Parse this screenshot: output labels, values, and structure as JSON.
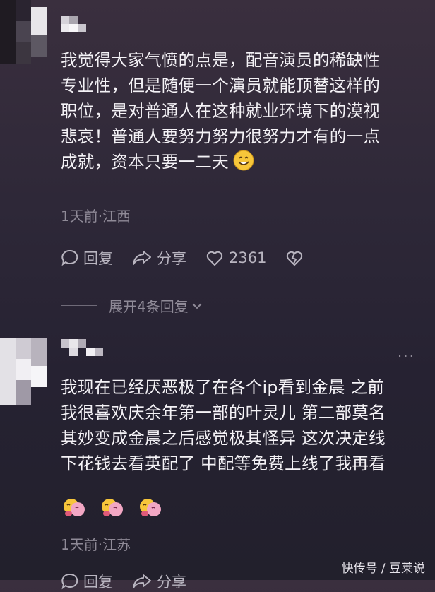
{
  "comments": [
    {
      "text_lines": [
        "我觉得大家气愤的点是，配音演员的稀缺性",
        "专业性，但是随便一个演员就能顶替这样的",
        "职位，是对普通人在这种就业环境下的漠视",
        "悲哀！普通人要努力努力很努力才有的一点",
        "成就，资本只要一二天"
      ],
      "trailing_emoji": "smile-emoji",
      "meta": "1天前·江西",
      "reply_label": "回复",
      "share_label": "分享",
      "like_count": "2361",
      "expand_label": "展开4条回复"
    },
    {
      "text_lines": [
        "我现在已经厌恶极了在各个ip看到金晨 之前",
        "我很喜欢庆余年第一部的叶灵儿 第二部莫名",
        "其妙变成金晨之后感觉极其怪异 这次决定线",
        "下花钱去看英配了 中配等免费上线了我再看"
      ],
      "emoji_row": [
        "hug-emoji",
        "hug-emoji",
        "hug-emoji"
      ],
      "meta": "1天前·江苏",
      "reply_label": "回复",
      "share_label": "分享",
      "more_label": "···"
    }
  ],
  "watermark": "快传号 / 豆莱说",
  "colors": {
    "background_top": "#3a2f3e",
    "background_bottom": "#22202c",
    "text": "#f4f2f6",
    "meta": "#8f8a97",
    "action": "#b9b5c0"
  }
}
